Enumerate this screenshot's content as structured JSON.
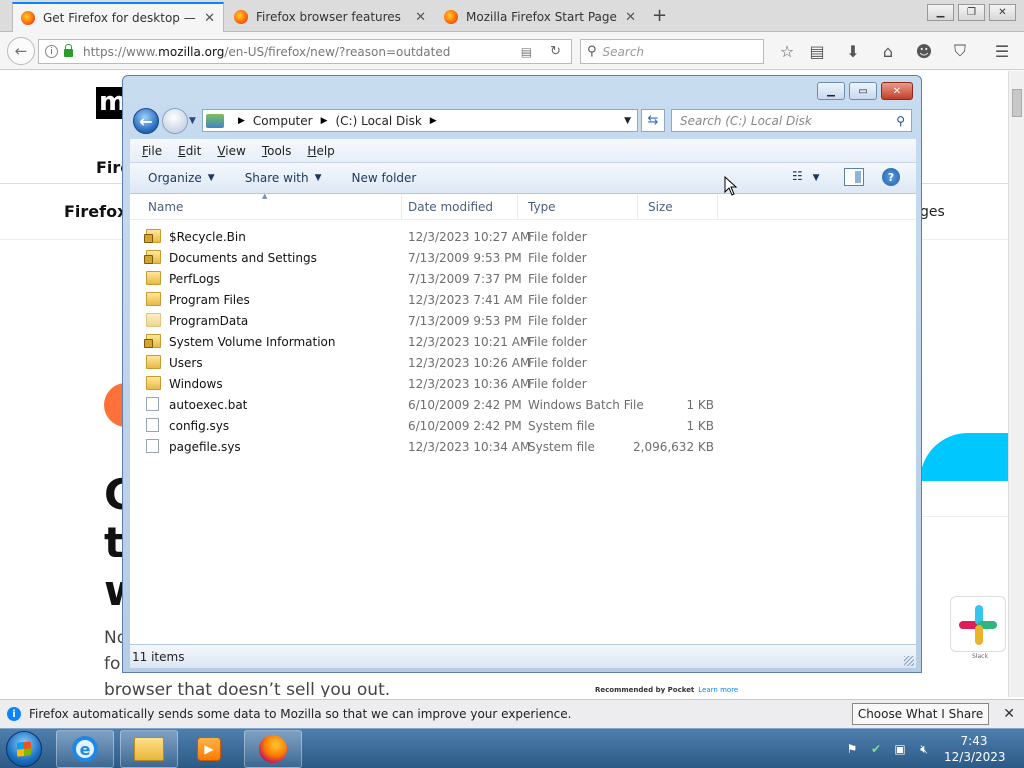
{
  "browser": {
    "tabs": [
      {
        "title": "Get Firefox for desktop — ...",
        "active": true
      },
      {
        "title": "Firefox browser features",
        "active": false
      },
      {
        "title": "Mozilla Firefox Start Page",
        "active": false
      }
    ],
    "new_tab_symbol": "+",
    "url_prefix": "https://www.",
    "url_domain": "mozilla.org",
    "url_path": "/en-US/firefox/new/?reason=outdated",
    "search_placeholder": "Search",
    "accent_color": "#0a84ff"
  },
  "page": {
    "logo_letter": "m",
    "nav_item_1": "Fire",
    "nav_item_2": "Firefox",
    "side_text": "ges",
    "headline_lines": [
      "G",
      "t",
      "w"
    ],
    "sub_lines": [
      "No",
      "fo",
      "browser that doesn’t sell you out."
    ],
    "pocket_label": "Recommended by Pocket",
    "pocket_link": "Learn more",
    "slack_label": "Slack"
  },
  "explorer": {
    "breadcrumb": [
      "Computer",
      "(C:) Local Disk"
    ],
    "search_placeholder": "Search (C:) Local Disk",
    "menu": [
      "File",
      "Edit",
      "View",
      "Tools",
      "Help"
    ],
    "commands": {
      "organize": "Organize",
      "share": "Share with",
      "new_folder": "New folder"
    },
    "columns": [
      "Name",
      "Date modified",
      "Type",
      "Size"
    ],
    "files": [
      {
        "name": "$Recycle.Bin",
        "date": "12/3/2023 10:27 AM",
        "type": "File folder",
        "size": "",
        "icon": "locked-folder-icon"
      },
      {
        "name": "Documents and Settings",
        "date": "7/13/2009 9:53 PM",
        "type": "File folder",
        "size": "",
        "icon": "locked-folder-icon"
      },
      {
        "name": "PerfLogs",
        "date": "7/13/2009 7:37 PM",
        "type": "File folder",
        "size": "",
        "icon": "folder-icon"
      },
      {
        "name": "Program Files",
        "date": "12/3/2023 7:41 AM",
        "type": "File folder",
        "size": "",
        "icon": "folder-icon"
      },
      {
        "name": "ProgramData",
        "date": "7/13/2009 9:53 PM",
        "type": "File folder",
        "size": "",
        "icon": "folder-icon"
      },
      {
        "name": "System Volume Information",
        "date": "12/3/2023 10:21 AM",
        "type": "File folder",
        "size": "",
        "icon": "locked-folder-icon"
      },
      {
        "name": "Users",
        "date": "12/3/2023 10:26 AM",
        "type": "File folder",
        "size": "",
        "icon": "folder-icon"
      },
      {
        "name": "Windows",
        "date": "12/3/2023 10:36 AM",
        "type": "File folder",
        "size": "",
        "icon": "folder-icon"
      },
      {
        "name": "autoexec.bat",
        "date": "6/10/2009 2:42 PM",
        "type": "Windows Batch File",
        "size": "1 KB",
        "icon": "batch-file-icon"
      },
      {
        "name": "config.sys",
        "date": "6/10/2009 2:42 PM",
        "type": "System file",
        "size": "1 KB",
        "icon": "system-file-icon"
      },
      {
        "name": "pagefile.sys",
        "date": "12/3/2023 10:34 AM",
        "type": "System file",
        "size": "2,096,632 KB",
        "icon": "system-file-icon"
      }
    ],
    "status": "11 items"
  },
  "notification": {
    "message": "Firefox automatically sends some data to Mozilla so that we can improve your experience.",
    "button": "Choose What I Share"
  },
  "taskbar": {
    "time": "7:43",
    "date": "12/3/2023"
  }
}
